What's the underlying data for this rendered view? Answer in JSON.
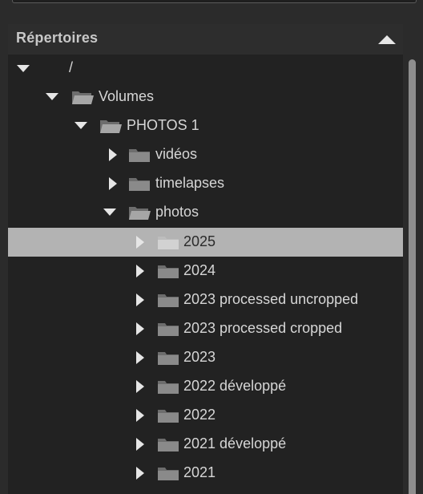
{
  "panel": {
    "title": "Répertoires"
  },
  "tree": [
    {
      "label": "/",
      "state": "expanded"
    },
    {
      "label": "Volumes",
      "state": "expanded"
    },
    {
      "label": "PHOTOS 1",
      "state": "expanded"
    },
    {
      "label": "vidéos",
      "state": "collapsed"
    },
    {
      "label": "timelapses",
      "state": "collapsed"
    },
    {
      "label": "photos",
      "state": "expanded"
    },
    {
      "label": "2025",
      "state": "collapsed",
      "selected": true
    },
    {
      "label": "2024",
      "state": "collapsed"
    },
    {
      "label": "2023 processed uncropped",
      "state": "collapsed"
    },
    {
      "label": "2023 processed cropped",
      "state": "collapsed"
    },
    {
      "label": "2023",
      "state": "collapsed"
    },
    {
      "label": "2022 développé",
      "state": "collapsed"
    },
    {
      "label": "2022",
      "state": "collapsed"
    },
    {
      "label": "2021 développé",
      "state": "collapsed"
    },
    {
      "label": "2021",
      "state": "collapsed"
    }
  ],
  "icons": {
    "collapse": "chevron-up-icon",
    "expanded": "triangle-down-icon",
    "collapsed": "triangle-right-icon",
    "folder": "folder-icon",
    "folder_open": "open-folder-icon"
  },
  "colors": {
    "panel_bg": "#2b2b2b",
    "tree_bg": "#222222",
    "selection": "#b3b3b3",
    "text": "#d6d6d6",
    "icon": "#e6e6e6",
    "folder": "#8a8a8a"
  }
}
